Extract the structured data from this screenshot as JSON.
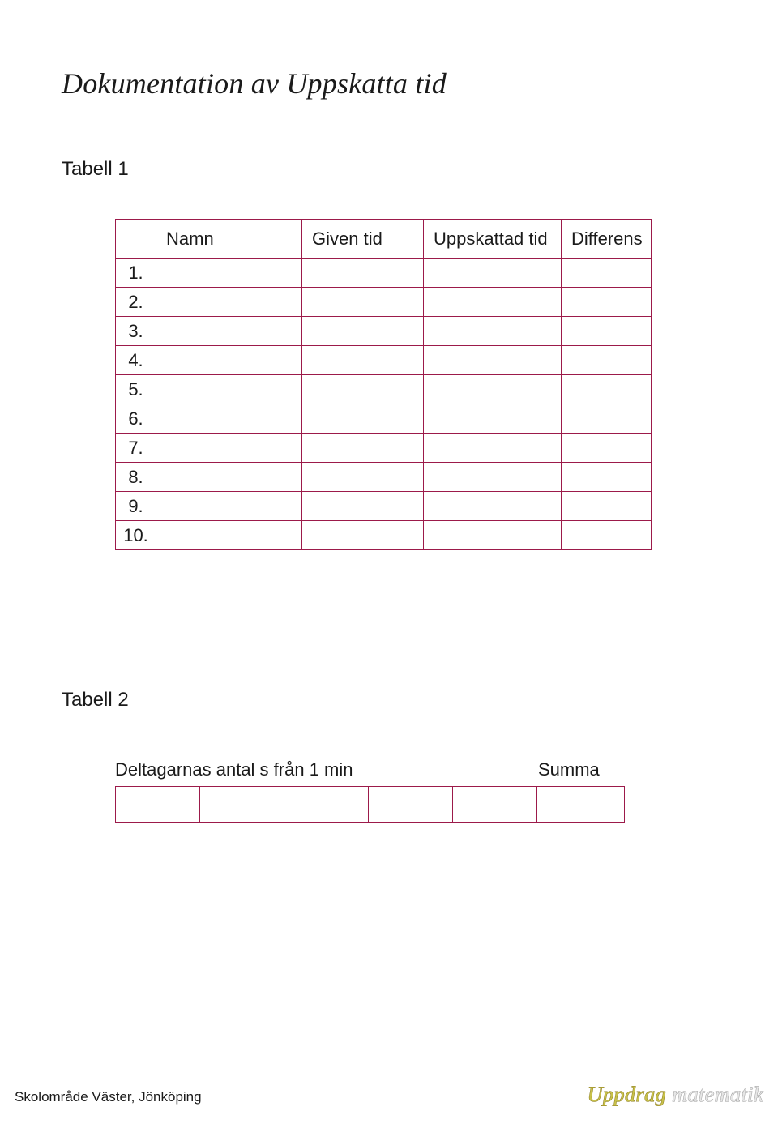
{
  "title": "Dokumentation av Uppskatta tid",
  "tabell1": {
    "label": "Tabell 1",
    "headers": {
      "col1": "",
      "col2": "Namn",
      "col3": "Given tid",
      "col4": "Uppskattad tid",
      "col5": "Differens"
    },
    "rows": [
      "1.",
      "2.",
      "3.",
      "4.",
      "5.",
      "6.",
      "7.",
      "8.",
      "9.",
      "10."
    ]
  },
  "tabell2": {
    "label": "Tabell 2",
    "desc": "Deltagarnas antal s från 1 min",
    "sum_label": "Summa"
  },
  "footer": {
    "left": "Skolområde Väster, Jönköping",
    "logo1": "Uppdrag",
    "logo2": " matematik"
  }
}
